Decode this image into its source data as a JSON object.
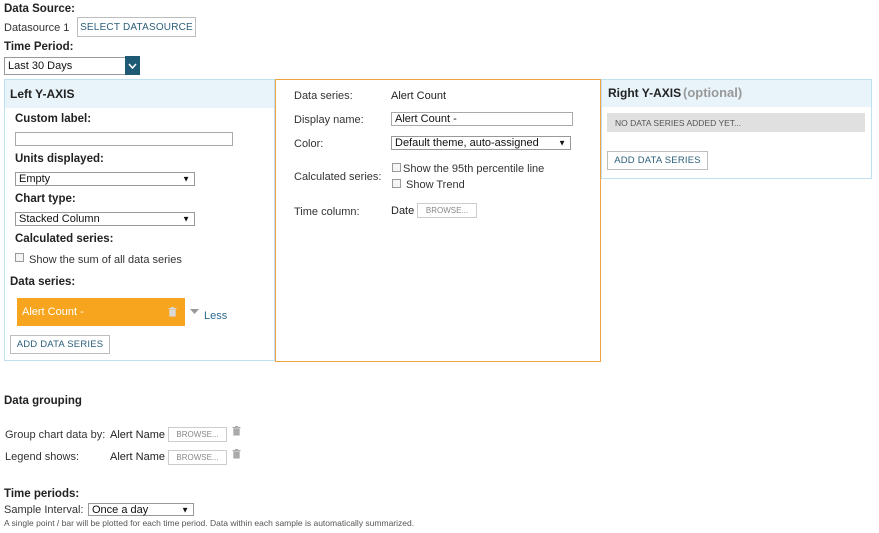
{
  "datasource": {
    "label": "Data Source:",
    "value": "Datasource 1",
    "select_button": "SELECT DATASOURCE"
  },
  "time_period": {
    "label": "Time Period:",
    "selected": "Last 30 Days"
  },
  "left_axis": {
    "title": "Left Y-AXIS",
    "custom_label": {
      "label": "Custom label:",
      "value": ""
    },
    "units": {
      "label": "Units displayed:",
      "selected": "Empty"
    },
    "chart_type": {
      "label": "Chart type:",
      "selected": "Stacked Column"
    },
    "calculated": {
      "label": "Calculated series:",
      "sum_option": "Show the sum of all data series"
    },
    "data_series_label": "Data series:",
    "series_tab": "Alert Count -",
    "less_link": "Less",
    "add_button": "ADD DATA SERIES"
  },
  "series_detail": {
    "data_series": {
      "label": "Data series:",
      "value": "Alert Count"
    },
    "display_name": {
      "label": "Display name:",
      "value": "Alert Count -"
    },
    "color": {
      "label": "Color:",
      "selected": "Default theme, auto-assigned"
    },
    "calculated": {
      "label": "Calculated series:",
      "percentile": "Show the 95th percentile line",
      "trend": "Show Trend"
    },
    "time_column": {
      "label": "Time column:",
      "value": "Date",
      "browse": "BROWSE..."
    }
  },
  "right_axis": {
    "title": "Right Y-AXIS",
    "optional": "(optional)",
    "empty_message": "NO DATA SERIES ADDED YET...",
    "add_button": "ADD DATA SERIES"
  },
  "data_grouping": {
    "title": "Data grouping",
    "group_by": {
      "label": "Group chart data by:",
      "value": "Alert Name",
      "browse": "BROWSE..."
    },
    "legend": {
      "label": "Legend shows:",
      "value": "Alert Name",
      "browse": "BROWSE..."
    }
  },
  "time_periods": {
    "title": "Time periods:",
    "sample_label": "Sample Interval:",
    "sample_selected": "Once a day",
    "note": "A single point / bar will be plotted for each time period. Data within each sample is automatically summarized."
  },
  "colors": {
    "accent_orange": "#f7a51f",
    "panel_border_blue": "#bfe0ee",
    "panel_header_blue": "#e9f4fa",
    "link_blue": "#2c6a8f",
    "dropdown_button": "#1f5a74"
  }
}
